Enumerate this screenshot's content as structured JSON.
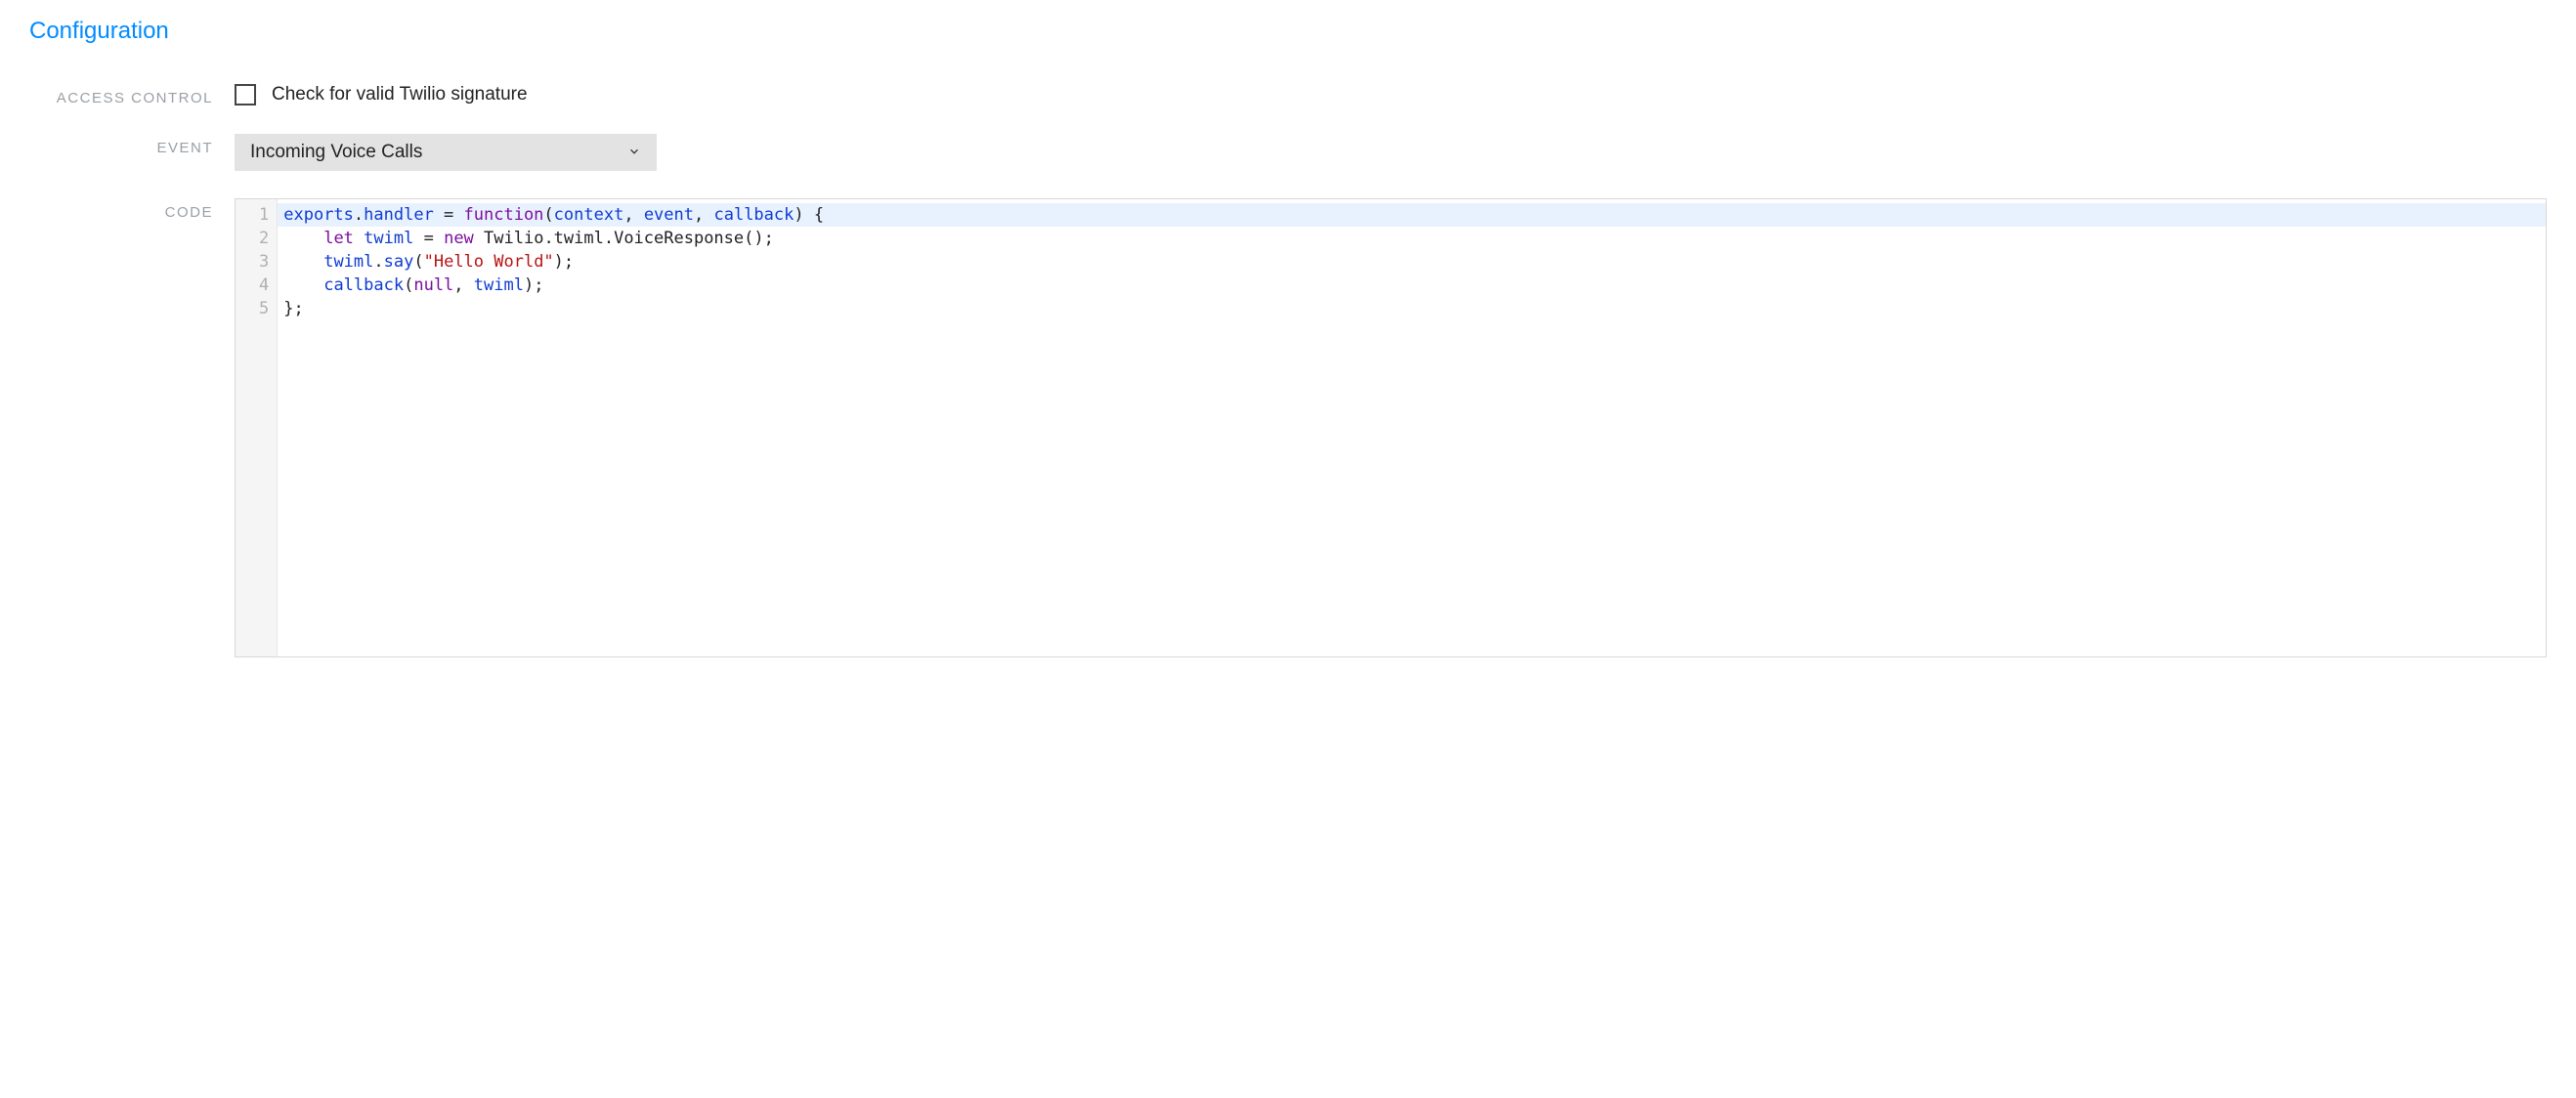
{
  "section": {
    "title": "Configuration"
  },
  "labels": {
    "access_control": "ACCESS CONTROL",
    "event": "EVENT",
    "code": "CODE"
  },
  "access_control": {
    "checkbox_label": "Check for valid Twilio signature",
    "checked": false
  },
  "event": {
    "selected": "Incoming Voice Calls"
  },
  "code": {
    "highlighted_line": 1,
    "lines": [
      {
        "n": 1,
        "tokens": [
          {
            "t": "exports",
            "c": "id"
          },
          {
            "t": ".",
            "c": "plain"
          },
          {
            "t": "handler",
            "c": "id"
          },
          {
            "t": " = ",
            "c": "plain"
          },
          {
            "t": "function",
            "c": "kw"
          },
          {
            "t": "(",
            "c": "plain"
          },
          {
            "t": "context",
            "c": "id"
          },
          {
            "t": ", ",
            "c": "plain"
          },
          {
            "t": "event",
            "c": "id"
          },
          {
            "t": ", ",
            "c": "plain"
          },
          {
            "t": "callback",
            "c": "id"
          },
          {
            "t": ") {",
            "c": "plain"
          }
        ]
      },
      {
        "n": 2,
        "tokens": [
          {
            "t": "    ",
            "c": "plain"
          },
          {
            "t": "let",
            "c": "kw"
          },
          {
            "t": " ",
            "c": "plain"
          },
          {
            "t": "twiml",
            "c": "id"
          },
          {
            "t": " = ",
            "c": "plain"
          },
          {
            "t": "new",
            "c": "kw"
          },
          {
            "t": " Twilio.twiml.VoiceResponse();",
            "c": "plain"
          }
        ]
      },
      {
        "n": 3,
        "tokens": [
          {
            "t": "    ",
            "c": "plain"
          },
          {
            "t": "twiml",
            "c": "id"
          },
          {
            "t": ".",
            "c": "plain"
          },
          {
            "t": "say",
            "c": "id"
          },
          {
            "t": "(",
            "c": "plain"
          },
          {
            "t": "\"Hello World\"",
            "c": "str"
          },
          {
            "t": ");",
            "c": "plain"
          }
        ]
      },
      {
        "n": 4,
        "tokens": [
          {
            "t": "    ",
            "c": "plain"
          },
          {
            "t": "callback",
            "c": "id"
          },
          {
            "t": "(",
            "c": "plain"
          },
          {
            "t": "null",
            "c": "null"
          },
          {
            "t": ", ",
            "c": "plain"
          },
          {
            "t": "twiml",
            "c": "id"
          },
          {
            "t": ");",
            "c": "plain"
          }
        ]
      },
      {
        "n": 5,
        "tokens": [
          {
            "t": "};",
            "c": "plain"
          }
        ]
      }
    ]
  }
}
